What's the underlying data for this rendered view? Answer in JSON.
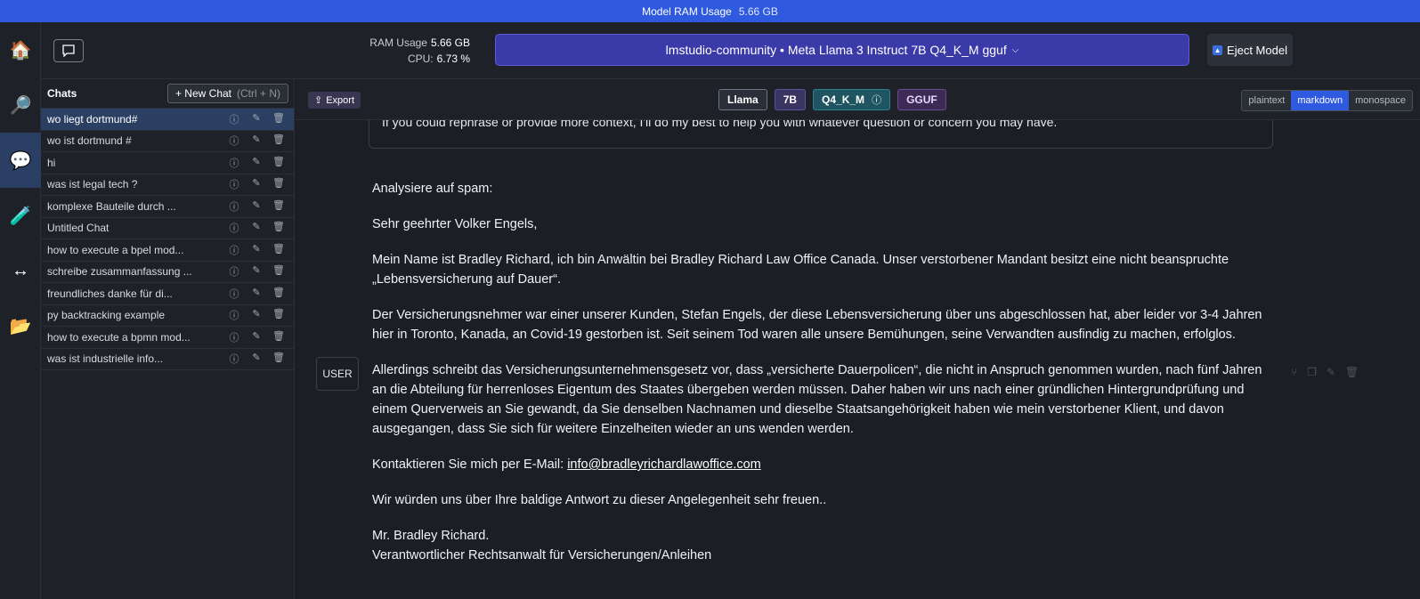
{
  "topbar": {
    "label": "Model RAM Usage",
    "value": "5.66 GB"
  },
  "rail": {
    "icons": [
      "home-icon",
      "search-icon",
      "chat-icon",
      "flask-icon",
      "arrows-icon",
      "folder-icon"
    ]
  },
  "header": {
    "ram_label": "RAM Usage",
    "ram_value": "5.66 GB",
    "cpu_label": "CPU:",
    "cpu_value": "6.73 %",
    "model": "lmstudio-community • Meta Llama 3 Instruct 7B Q4_K_M gguf",
    "eject_label": "Eject Model"
  },
  "sidebar": {
    "title": "Chats",
    "new_chat_label": "+ New Chat",
    "new_chat_shortcut": "(Ctrl + N)",
    "chats": [
      "wo liegt dortmund#",
      "wo ist dortmund #",
      "hi",
      "was ist legal tech ?",
      "komplexe Bauteile durch ...",
      "Untitled Chat",
      "how to execute a bpel mod...",
      "schreibe zusammanfassung ...",
      "freundliches danke für di...",
      "py backtracking example",
      "how to execute a bpmn mod...",
      "was ist industrielle info..."
    ]
  },
  "toolbar": {
    "export_label": "Export",
    "tags": [
      "Llama",
      "7B",
      "Q4_K_M",
      "GGUF"
    ],
    "formats": [
      "plaintext",
      "markdown",
      "monospace"
    ],
    "active_format": "markdown"
  },
  "conversation": {
    "previous_message": "If you could rephrase or provide more context, I'll do my best to help you with whatever question or concern you may have.",
    "user_role": "USER",
    "paragraphs": [
      "Analysiere auf spam:",
      "Sehr geehrter Volker Engels,",
      "Mein Name ist Bradley Richard, ich bin Anwältin bei Bradley Richard Law Office Canada. Unser verstorbener Mandant besitzt eine nicht beanspruchte „Lebensversicherung auf Dauer“.",
      "Der Versicherungsnehmer war einer unserer Kunden, Stefan Engels, der diese Lebensversicherung über uns abgeschlossen hat, aber leider vor 3-4 Jahren hier in Toronto, Kanada, an Covid-19 gestorben ist. Seit seinem Tod waren alle unsere Bemühungen, seine Verwandten ausfindig zu machen, erfolglos.",
      "Allerdings schreibt das Versicherungsunternehmensgesetz vor, dass „versicherte Dauerpolicen“, die nicht in Anspruch genommen wurden, nach fünf Jahren an die Abteilung für herrenloses Eigentum des Staates übergeben werden müssen. Daher haben wir uns nach einer gründlichen Hintergrundprüfung und einem Querverweis an Sie gewandt, da Sie denselben Nachnamen und dieselbe Staatsangehörigkeit haben wie mein verstorbener Klient, und davon ausgegangen, dass Sie sich für weitere Einzelheiten wieder an uns wenden werden."
    ],
    "contact_prefix": "Kontaktieren Sie mich per E-Mail: ",
    "contact_email": "info@bradleyrichardlawoffice.com",
    "closing": "Wir würden uns über Ihre baldige Antwort zu dieser Angelegenheit sehr freuen..",
    "signature_name": "Mr. Bradley Richard.",
    "signature_title": "Verantwortlicher Rechtsanwalt für Versicherungen/Anleihen"
  },
  "colors": {
    "accent": "#2f5ae0",
    "model_bar": "#3a3aa8",
    "selected_row": "#2b3f63"
  }
}
